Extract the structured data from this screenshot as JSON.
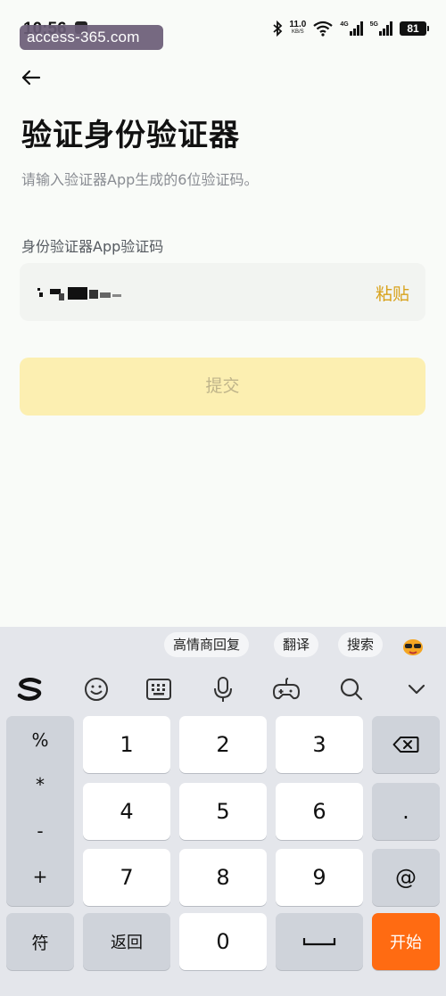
{
  "status_bar": {
    "time": "10:56",
    "watermark": "access-365.com",
    "net_speed": "11.0",
    "net_unit": "KB/S",
    "signal_1": "4G",
    "signal_2": "5G",
    "battery": "81"
  },
  "page": {
    "title": "验证身份验证器",
    "subtitle": "请输入验证器App生成的6位验证码。",
    "field_label": "身份验证器App验证码",
    "paste_label": "粘贴",
    "submit_label": "提交"
  },
  "keyboard": {
    "suggestions": [
      "高情商回复",
      "翻译",
      "搜索"
    ],
    "symbols": [
      "%",
      "*",
      "-",
      "+"
    ],
    "digits": [
      "1",
      "2",
      "3",
      "4",
      "5",
      "6",
      "7",
      "8",
      "9",
      "0"
    ],
    "dot": ".",
    "at": "@",
    "sym_label": "符",
    "back_label": "返回",
    "start_label": "开始"
  },
  "colors": {
    "accent": "#d8a21c",
    "submit_bg": "#fcefb1",
    "go_key": "#ff6b12"
  }
}
